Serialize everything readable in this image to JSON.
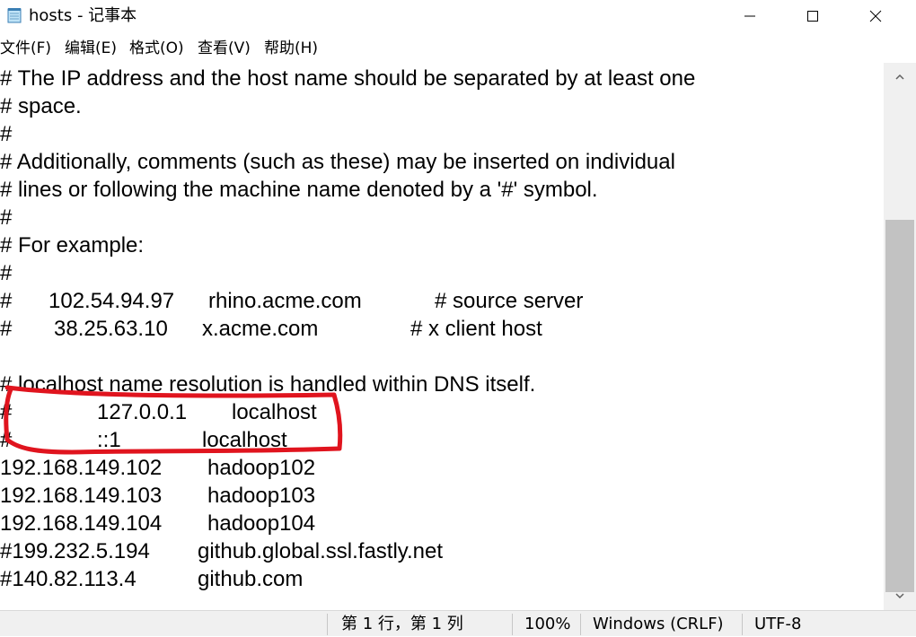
{
  "window": {
    "title": "hosts - 记事本",
    "app_icon": "notepad-icon",
    "controls": [
      "minimize-icon",
      "maximize-icon",
      "close-icon"
    ]
  },
  "menu": [
    {
      "label": "文件(F)"
    },
    {
      "label": "编辑(E)"
    },
    {
      "label": "格式(O)"
    },
    {
      "label": "查看(V)"
    },
    {
      "label": "帮助(H)"
    }
  ],
  "editor": {
    "lines": [
      [
        "# The IP address and the host name should be separated by at least one"
      ],
      [
        "# space."
      ],
      [
        "#"
      ],
      [
        "# Additionally, comments (such as these) may be inserted on individual"
      ],
      [
        "# lines or following the machine name denoted by a '#' symbol."
      ],
      [
        "#"
      ],
      [
        "# For example:"
      ],
      [
        "#"
      ],
      [
        "#",
        "102.54.94.97",
        "rhino.acme.com",
        "# source server"
      ],
      [
        "#",
        "38.25.63.10",
        "x.acme.com",
        "# x client host"
      ],
      [
        ""
      ],
      [
        "# localhost name resolution is handled within DNS itself."
      ],
      [
        "#",
        "127.0.0.1",
        "localhost"
      ],
      [
        "#",
        "::1",
        "localhost"
      ],
      [
        "192.168.149.102",
        "hadoop102"
      ],
      [
        "192.168.149.103",
        "hadoop103"
      ],
      [
        "192.168.149.104",
        "hadoop104"
      ],
      [
        "#199.232.5.194",
        "github.global.ssl.fastly.net"
      ],
      [
        "#140.82.113.4",
        "github.com"
      ]
    ],
    "annotation_color": "#e0141e"
  },
  "status": {
    "position": "第 1 行，第 1 列",
    "zoom": "100%",
    "line_ending": "Windows (CRLF)",
    "encoding": "UTF-8"
  },
  "colors": {
    "background": "#ffffff",
    "chrome": "#f0f0f0",
    "scroll_thumb": "#c2c2c2"
  }
}
